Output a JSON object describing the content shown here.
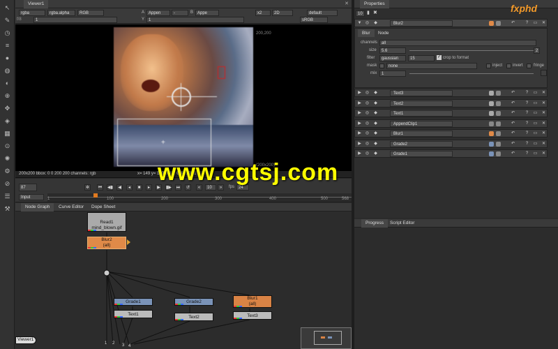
{
  "toolbar": {
    "icons": [
      "pointer-icon",
      "paint-brush-icon",
      "time-icon",
      "channel-icon",
      "color-icon",
      "filter-icon",
      "keyer-icon",
      "merge-icon",
      "transform-icon",
      "3d-icon",
      "views-icon",
      "metadata-icon",
      "particles-icon",
      "other-icon",
      "furnace-icon",
      "toolsets-icon",
      "settings-icon"
    ]
  },
  "viewer": {
    "tab": "Viewer1",
    "row1": {
      "channels": "rgba",
      "alpha": "rgba.alpha",
      "colorspace": "RGB",
      "a_label": "A",
      "a_input": "Appen",
      "a_op": "-",
      "b_label": "B",
      "b_input": "Appe",
      "zoom": "x2",
      "view": "2D",
      "lut": "default"
    },
    "row2": {
      "fstop": "f/8",
      "frame": "1",
      "y_label": "Y",
      "y_value": "1",
      "display": "sRGB"
    },
    "format_top": "200,200",
    "format_bottom": "(200x200)",
    "info_left": "200x200 bbox: 0 0 200 200 channels: rgb",
    "info_right": "x= 149 y= 129  0.3 ... 0.4 ... 0.11",
    "frame_current": "87",
    "input_mode": "Input",
    "play_count": "10",
    "fps_label": "fps",
    "fps": "24",
    "ruler": [
      "1",
      "100",
      "200",
      "300",
      "400",
      "500",
      "568"
    ]
  },
  "watermark": {
    "site": "www.cgtsj.com",
    "logo": "fxphd"
  },
  "nodegraph": {
    "tabs": [
      "Node Graph",
      "Curve Editor",
      "Dope Sheet"
    ],
    "nodes": {
      "read": "Read1",
      "read_file": "mind_blown.gif",
      "blur2": "Blur2",
      "blur2_ch": "(all)",
      "grade1": "Grade1",
      "grade2": "Grade2",
      "blur1": "Blur1",
      "blur1_ch": "(all)",
      "text1": "Text1",
      "text2": "Text2",
      "text3": "Text3",
      "viewer": "Viewer1"
    },
    "inputs": [
      "1",
      "2",
      "3",
      "4"
    ]
  },
  "properties": {
    "tab": "Properties",
    "max_panels": "10",
    "active_node": "Blur2",
    "subtabs": [
      "Blur",
      "Node"
    ],
    "channels_label": "channels",
    "channels_value": "all",
    "size_label": "size",
    "size_value": "5.6",
    "size_count": "2",
    "filter_label": "filter",
    "filter_value": "gaussian",
    "quality": "15",
    "crop_label": "crop to format",
    "mask_label": "mask",
    "mask_value": "none",
    "inject_label": "inject",
    "invert_label": "invert",
    "fringe_label": "fringe",
    "mix_label": "mix",
    "mix_value": "1",
    "panels": [
      "Text3",
      "Text2",
      "Text1",
      "AppendClip1",
      "Blur1",
      "Grade2",
      "Grade1"
    ]
  },
  "bottom_right": {
    "tabs": [
      "Progress",
      "Script Editor"
    ]
  }
}
